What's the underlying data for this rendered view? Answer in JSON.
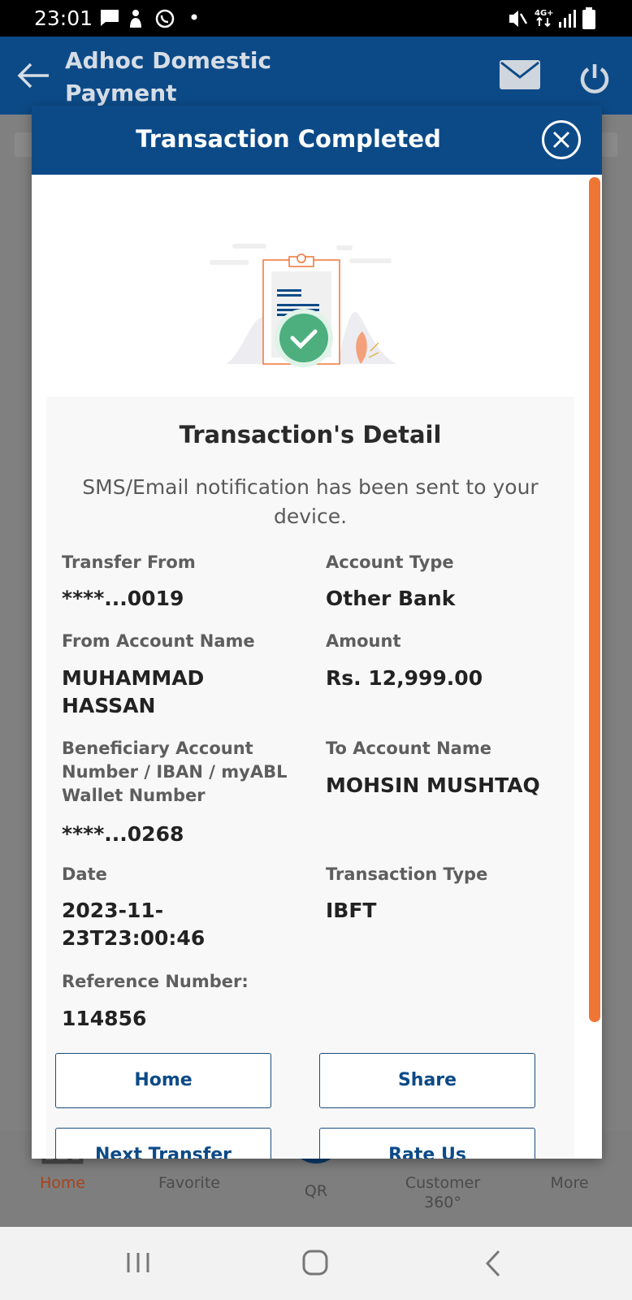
{
  "status": {
    "time": "23:01"
  },
  "app": {
    "title_line1": "Adhoc Domestic",
    "title_line2": "Payment"
  },
  "modal": {
    "title": "Transaction Completed",
    "detail_title": "Transaction's Detail",
    "notice": "SMS/Email notification has been sent to your device.",
    "fields": {
      "transfer_from": {
        "label": "Transfer From",
        "value": "****...0019"
      },
      "account_type": {
        "label": "Account Type",
        "value": "Other Bank"
      },
      "from_account_name": {
        "label": "From Account Name",
        "value_line1": "MUHAMMAD",
        "value_line2": "HASSAN"
      },
      "amount": {
        "label": "Amount",
        "value": "Rs. 12,999.00"
      },
      "beneficiary": {
        "label_line1": "Beneficiary Account",
        "label_line2": "Number / IBAN / myABL",
        "label_line3": "Wallet Number",
        "value": "****...0268"
      },
      "to_account_name": {
        "label": "To Account Name",
        "value": "MOHSIN MUSHTAQ"
      },
      "date": {
        "label": "Date",
        "value_line1": "2023-11-",
        "value_line2": "23T23:00:46"
      },
      "transaction_type": {
        "label": "Transaction Type",
        "value": "IBFT"
      },
      "reference": {
        "label": "Reference Number:",
        "value": "114856"
      }
    },
    "buttons": {
      "home": "Home",
      "share": "Share",
      "next_transfer": "Next Transfer",
      "rate_us": "Rate Us"
    }
  },
  "bottom_nav": {
    "home": "Home",
    "favorite": "Favorite",
    "qr": "QR",
    "customer_line1": "Customer",
    "customer_line2": "360°",
    "more": "More"
  },
  "colors": {
    "primary": "#0c4a87",
    "accent": "#ef7535",
    "success": "#4caf7d"
  }
}
